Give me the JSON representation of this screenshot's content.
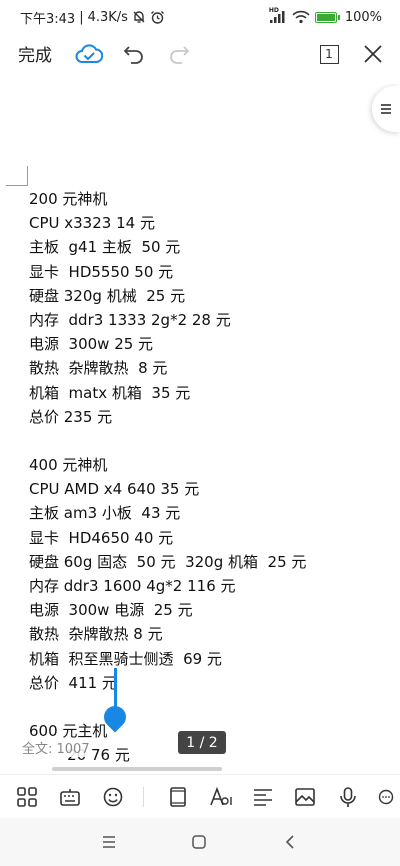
{
  "status_bar": {
    "time": "下午3:43",
    "separator": "|",
    "net_speed": "4.3K/s",
    "signal_label": "HD",
    "battery_pct": "100%"
  },
  "toolbar": {
    "done_label": "完成",
    "page_count_box": "1",
    "icons": [
      "cloud-check-icon",
      "undo-icon",
      "redo-icon",
      "page-count-icon",
      "close-icon"
    ]
  },
  "document": {
    "lines": [
      "200 元神机",
      "CPU x3323 14 元",
      "主板  g41 主板  50 元",
      "显卡  HD5550 50 元",
      "硬盘 320g 机械  25 元",
      "内存  ddr3 1333 2g*2 28 元",
      "电源  300w 25 元",
      "散热  杂牌散热  8 元",
      "机箱  matx 机箱  35 元",
      "总价 235 元",
      "",
      "400 元神机",
      "CPU AMD x4 640 35 元",
      "主板 am3 小板  43 元",
      "显卡  HD4650 40 元",
      "硬盘 60g 固态  50 元  320g 机箱  25 元",
      "内存 ddr3 1600 4g*2 116 元",
      "电源  300w 电源  25 元",
      "散热  杂牌散热 8 元",
      "机箱  积至黑骑士侧透  69 元",
      "总价  411 元",
      "",
      "600 元主机",
      "        20 76 元"
    ]
  },
  "word_count": "全文: 1007",
  "page_indicator": "1 / 2",
  "colors": {
    "accent": "#1b87e5",
    "battery": "#3aaa35",
    "text": "#111111"
  }
}
